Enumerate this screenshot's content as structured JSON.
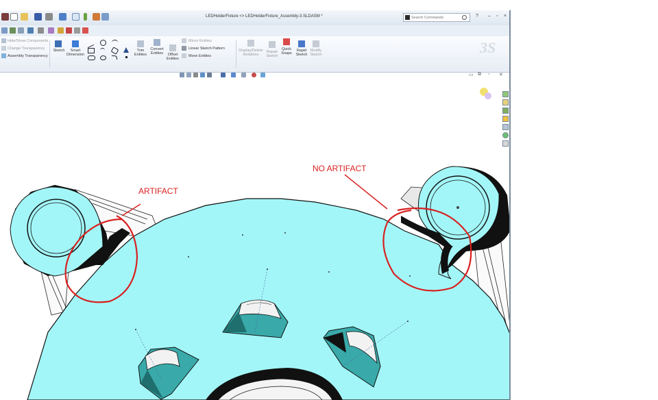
{
  "window": {
    "title": "LEDHolderFixture <> LEDHolderFixture_Assembly-3.SLDASM *",
    "search_placeholder": "Search Commands",
    "help_glyph": "?"
  },
  "ribbon": {
    "assembly_group": {
      "hide_show": "Hide/Show Components",
      "change_transparency": "Change Transparency",
      "assembly_transparency": "Assembly Transparency"
    },
    "tools": {
      "sketch": "Sketch",
      "smart_dimension": [
        "Smart",
        "Dimension"
      ],
      "trim_entities": [
        "Trim",
        "Entities"
      ],
      "convert_entities": [
        "Convert",
        "Entities"
      ],
      "offset_entities": [
        "Offset",
        "Entities"
      ],
      "mirror_entities": "Mirror Entities",
      "linear_sketch_pattern": "Linear Sketch Pattern",
      "move_entities": "Move Entities",
      "display_delete_relations": [
        "Display/Delete",
        "Relations"
      ],
      "repair_sketch": [
        "Repair",
        "Sketch"
      ],
      "quick_snaps": [
        "Quick",
        "Snaps"
      ],
      "rapid_sketch": [
        "Rapid",
        "Sketch"
      ],
      "modify_sketch": [
        "Modify",
        "Sketch"
      ]
    },
    "logo": "3S"
  },
  "annotations": {
    "artifact": "ARTIFACT",
    "no_artifact": "NO ARTIFACT",
    "color": "#d92020"
  },
  "colors": {
    "part_face": "#a3f6f7",
    "hole_wall": "#3aa9a9",
    "edge": "#111111"
  }
}
